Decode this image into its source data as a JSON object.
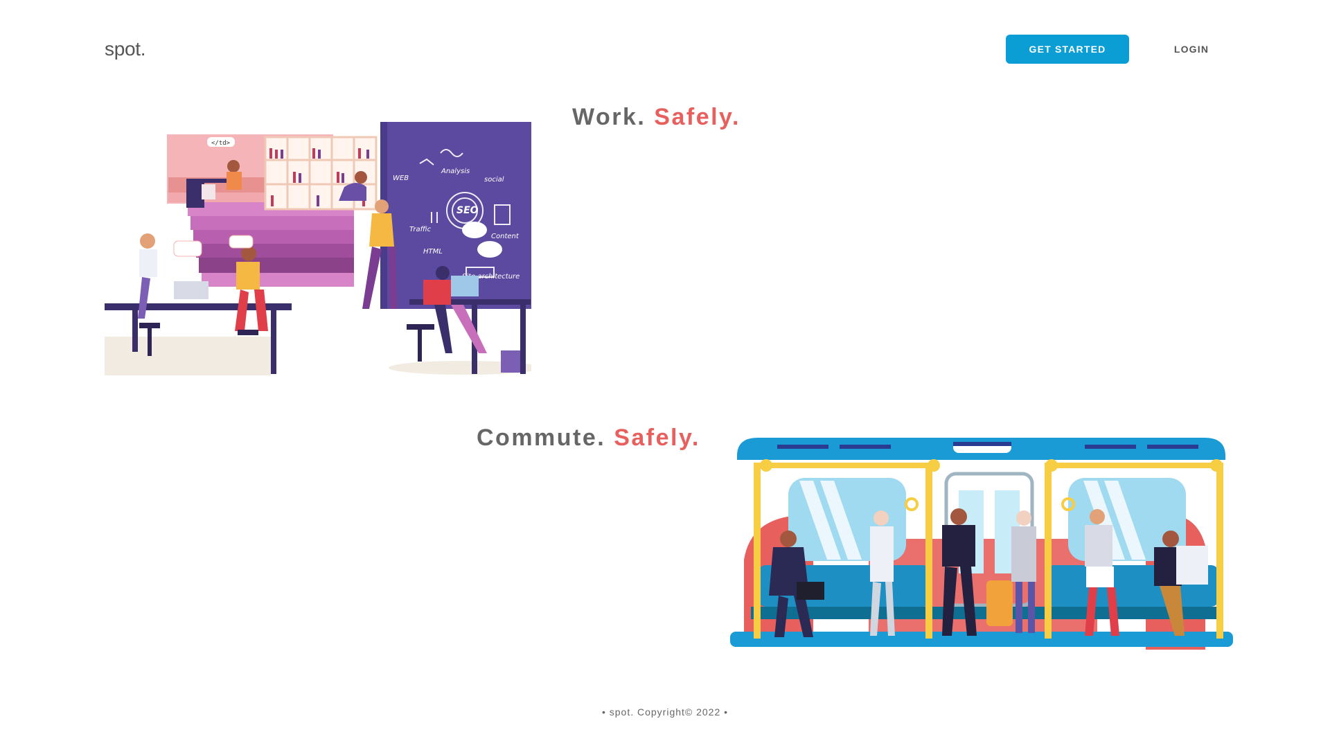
{
  "header": {
    "logo": "spot.",
    "get_started_label": "GET STARTED",
    "login_label": "LOGIN"
  },
  "sections": {
    "work": {
      "word": "Work.",
      "accent": "Safely."
    },
    "commute": {
      "word": "Commute.",
      "accent": "Safely."
    }
  },
  "footer": {
    "text": "• spot. Copyright© 2022 •"
  },
  "colors": {
    "accent_blue": "#0a9ed4",
    "accent_red": "#e8605e",
    "text_gray": "#666666"
  },
  "illustrations": {
    "work": "office-coworking-illustration",
    "commute": "subway-commute-illustration"
  }
}
